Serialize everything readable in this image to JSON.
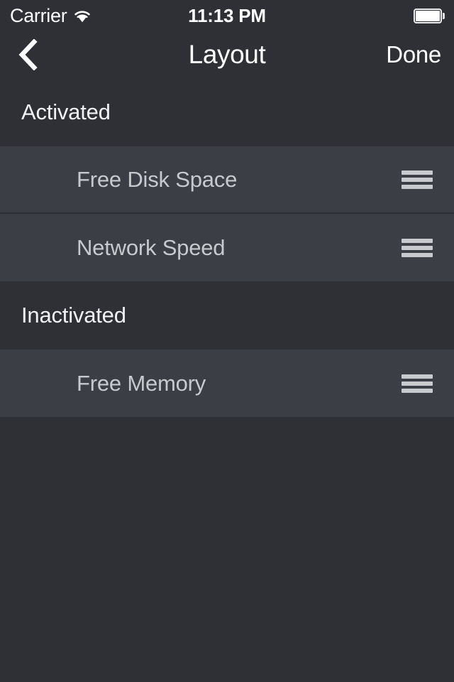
{
  "status_bar": {
    "carrier": "Carrier",
    "wifi_icon": "wifi-icon",
    "time": "11:13 PM",
    "battery_icon": "battery-full-icon"
  },
  "nav_bar": {
    "back_icon": "chevron-left-icon",
    "title": "Layout",
    "done_label": "Done"
  },
  "sections": [
    {
      "header": "Activated",
      "rows": [
        {
          "label": "Free Disk Space",
          "handle_icon": "reorder-handle-icon"
        },
        {
          "label": "Network Speed",
          "handle_icon": "reorder-handle-icon"
        }
      ]
    },
    {
      "header": "Inactivated",
      "rows": [
        {
          "label": "Free Memory",
          "handle_icon": "reorder-handle-icon"
        }
      ]
    }
  ],
  "colors": {
    "page_background": "#2e3036",
    "row_background": "#3b3e44",
    "separator": "#2b2d33",
    "header_text": "#f2f2f4",
    "row_text": "#c7c9cd",
    "accent_white": "#ffffff"
  }
}
